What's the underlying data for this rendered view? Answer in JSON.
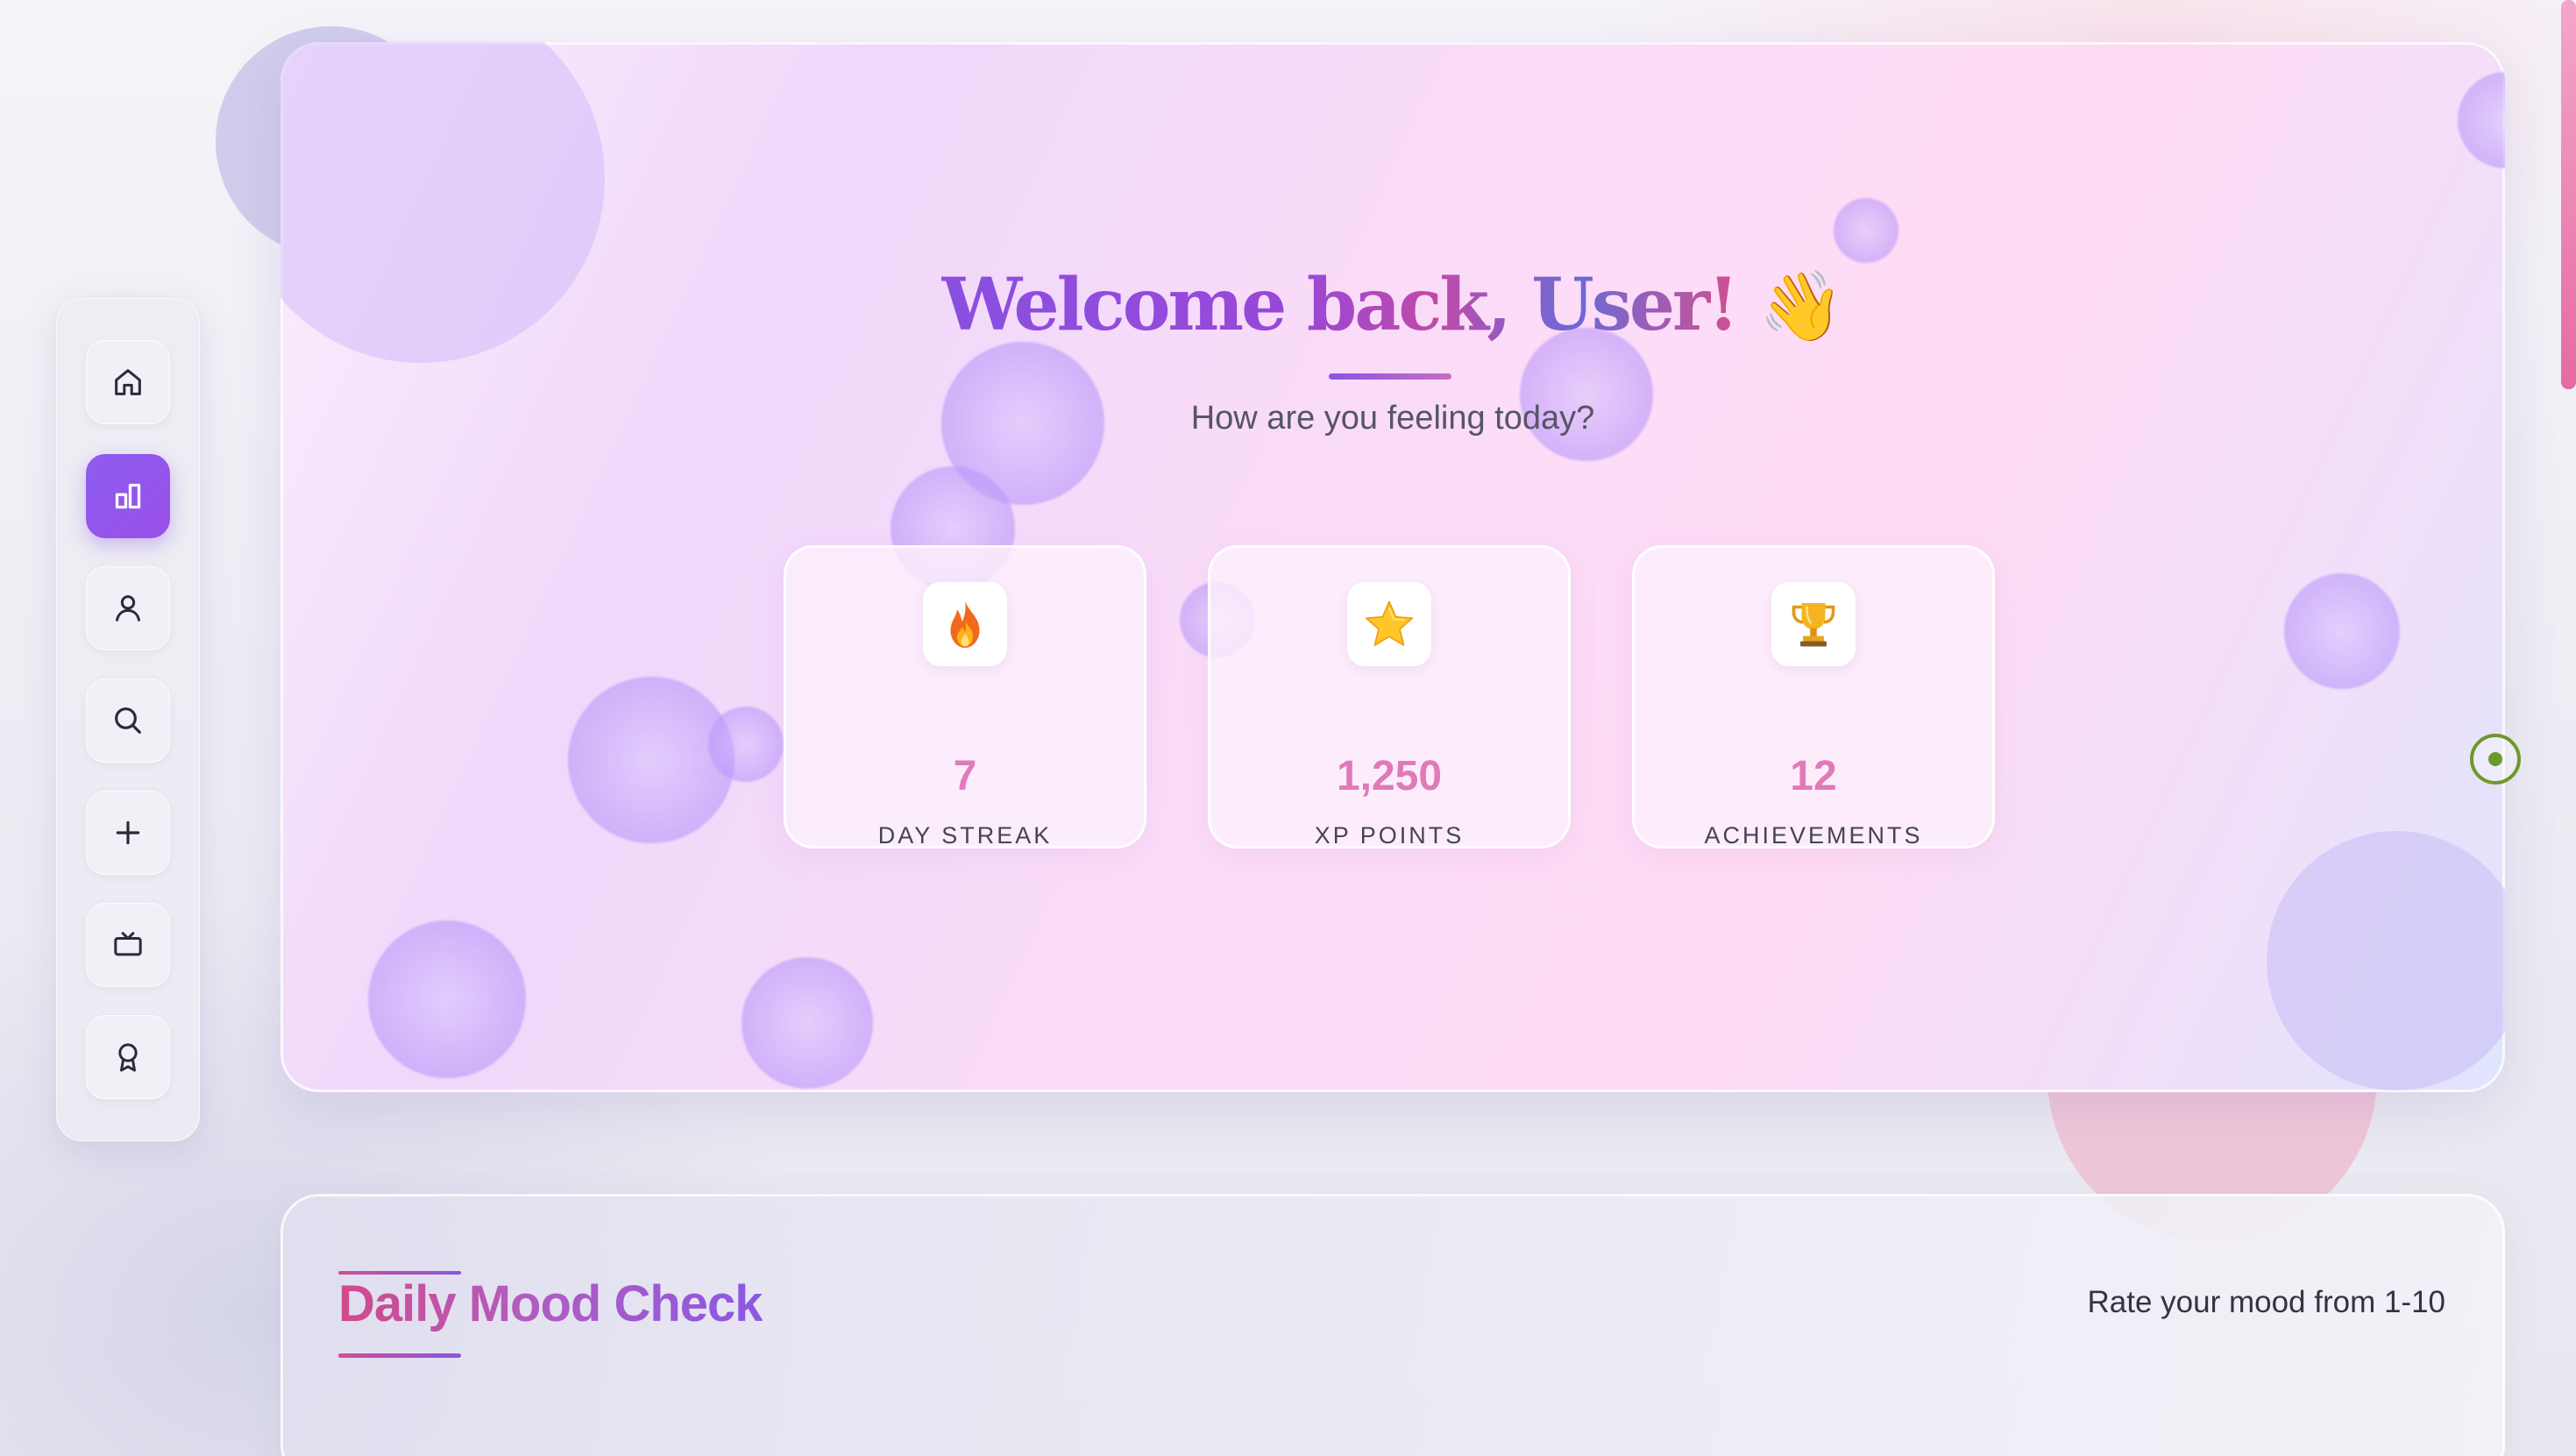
{
  "theme": {
    "accent": "#8c5cf0",
    "title_gradient_start": "#8a4fe0",
    "title_gradient_end": "#d05090",
    "stat_value_color": "#e07ab8"
  },
  "sidebar": {
    "items": [
      {
        "id": "home",
        "icon": "home-icon",
        "active": false
      },
      {
        "id": "stats",
        "icon": "bar-chart-icon",
        "active": true
      },
      {
        "id": "profile",
        "icon": "user-icon",
        "active": false
      },
      {
        "id": "search",
        "icon": "search-icon",
        "active": false
      },
      {
        "id": "add",
        "icon": "plus-icon",
        "active": false
      },
      {
        "id": "media",
        "icon": "tv-icon",
        "active": false
      },
      {
        "id": "awards",
        "icon": "award-icon",
        "active": false
      }
    ]
  },
  "hero": {
    "title": "Welcome back, User!",
    "wave": "👋",
    "subtitle": "How are you feeling today?",
    "stats": [
      {
        "icon": "fire-icon",
        "value": "7",
        "label": "DAY STREAK"
      },
      {
        "icon": "star-icon",
        "value": "1,250",
        "label": "XP POINTS"
      },
      {
        "icon": "trophy-icon",
        "value": "12",
        "label": "ACHIEVEMENTS"
      }
    ]
  },
  "mood": {
    "title": "Daily Mood Check",
    "hint": "Rate your mood from 1-10"
  }
}
